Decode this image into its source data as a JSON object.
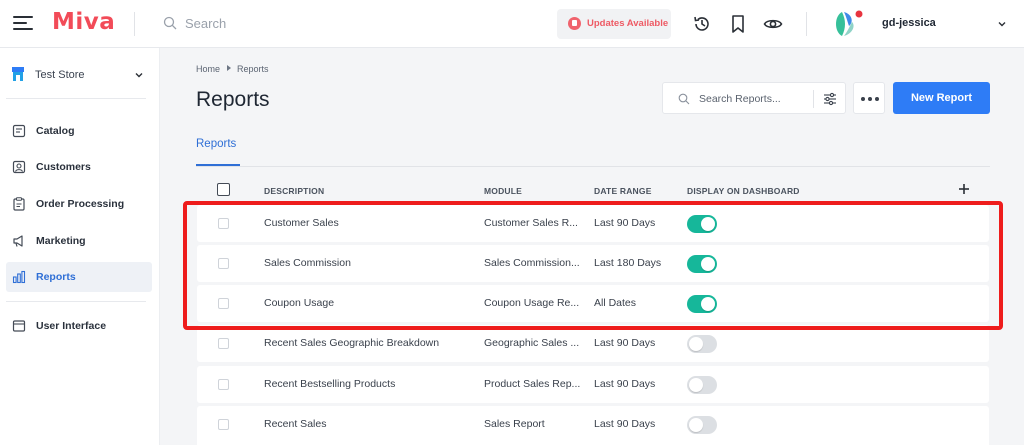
{
  "topbar": {
    "logo": "Miva",
    "search_placeholder": "Search",
    "updates_label": "Updates Available",
    "username": "gd-jessica"
  },
  "sidebar": {
    "store_label": "Test Store",
    "items": [
      {
        "label": "Catalog",
        "icon": "catalog-icon"
      },
      {
        "label": "Customers",
        "icon": "customers-icon"
      },
      {
        "label": "Order Processing",
        "icon": "clipboard-icon"
      },
      {
        "label": "Marketing",
        "icon": "megaphone-icon"
      },
      {
        "label": "Reports",
        "icon": "bar-chart-icon",
        "active": true
      },
      {
        "label": "User Interface",
        "icon": "window-icon"
      }
    ]
  },
  "breadcrumb": {
    "home": "Home",
    "current": "Reports"
  },
  "page_title": "Reports",
  "toolbar": {
    "search_placeholder": "Search Reports...",
    "new_report_label": "New Report"
  },
  "tabs": [
    {
      "label": "Reports",
      "active": true
    }
  ],
  "table": {
    "headers": {
      "description": "DESCRIPTION",
      "module": "MODULE",
      "date_range": "DATE RANGE",
      "display": "DISPLAY ON DASHBOARD"
    },
    "rows": [
      {
        "description": "Customer Sales",
        "module": "Customer Sales R...",
        "date_range": "Last 90 Days",
        "display": true
      },
      {
        "description": "Sales Commission",
        "module": "Sales Commission...",
        "date_range": "Last 180 Days",
        "display": true
      },
      {
        "description": "Coupon Usage",
        "module": "Coupon Usage Re...",
        "date_range": "All Dates",
        "display": true
      },
      {
        "description": "Recent Sales Geographic Breakdown",
        "module": "Geographic Sales ...",
        "date_range": "Last 90 Days",
        "display": false
      },
      {
        "description": "Recent Bestselling Products",
        "module": "Product Sales Rep...",
        "date_range": "Last 90 Days",
        "display": false
      },
      {
        "description": "Recent Sales",
        "module": "Sales Report",
        "date_range": "Last 90 Days",
        "display": false
      }
    ]
  },
  "colors": {
    "brand": "#f24b58",
    "primary": "#2e7cf6",
    "toggle_on": "#16b79a",
    "highlight": "#ee1c1c"
  }
}
